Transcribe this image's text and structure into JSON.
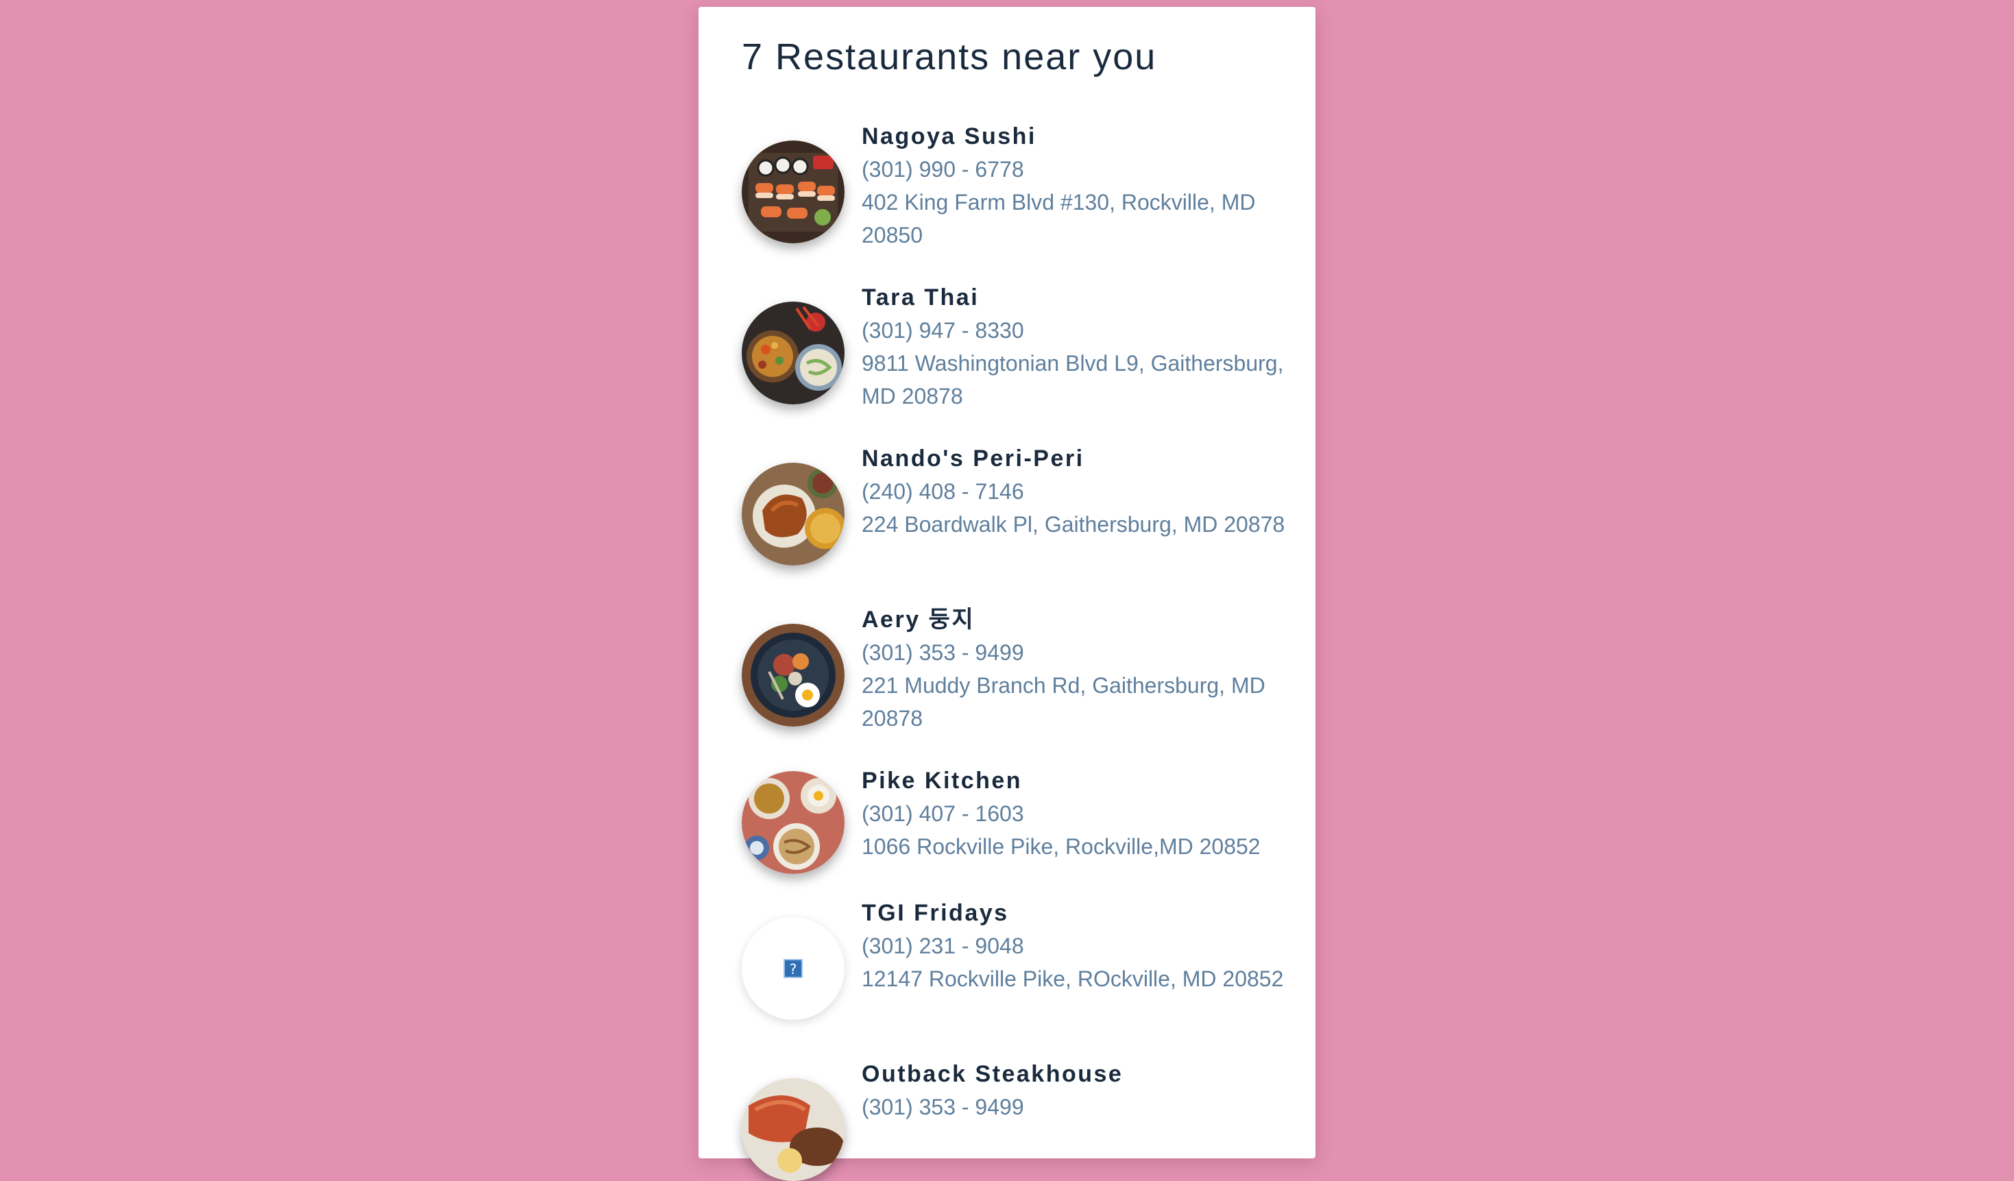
{
  "page": {
    "title": "7 Restaurants near you",
    "background_color": "#e291b0"
  },
  "restaurants": [
    {
      "name": "Nagoya Sushi",
      "phone": "(301) 990 - 6778",
      "address": "402 King Farm Blvd #130, Rockville, MD 20850",
      "image": "sushi-platter-photo"
    },
    {
      "name": "Tara Thai",
      "phone": "(301) 947 - 8330",
      "address": "9811 Washingtonian Blvd L9, Gaithersburg, MD 20878",
      "image": "thai-dishes-photo"
    },
    {
      "name": "Nando's Peri-Peri",
      "phone": "(240) 408 - 7146",
      "address": "224 Boardwalk Pl, Gaithersburg, MD 20878",
      "image": "peri-peri-chicken-photo"
    },
    {
      "name": "Aery 둥지",
      "phone": "(301) 353 - 9499",
      "address": "221 Muddy Branch Rd, Gaithersburg, MD 20878",
      "image": "bibimbap-bowl-photo"
    },
    {
      "name": "Pike Kitchen",
      "phone": "(301) 407 - 1603",
      "address": "1066 Rockville Pike, Rockville,MD 20852",
      "image": "asian-dishes-photo"
    },
    {
      "name": "TGI Fridays",
      "phone": "(301) 231 - 9048",
      "address": "12147 Rockville Pike, ROckville, MD 20852",
      "image": "broken-image-icon"
    },
    {
      "name": "Outback Steakhouse",
      "phone": "(301) 353 - 9499",
      "address": "",
      "image": "steak-lobster-photo"
    }
  ]
}
